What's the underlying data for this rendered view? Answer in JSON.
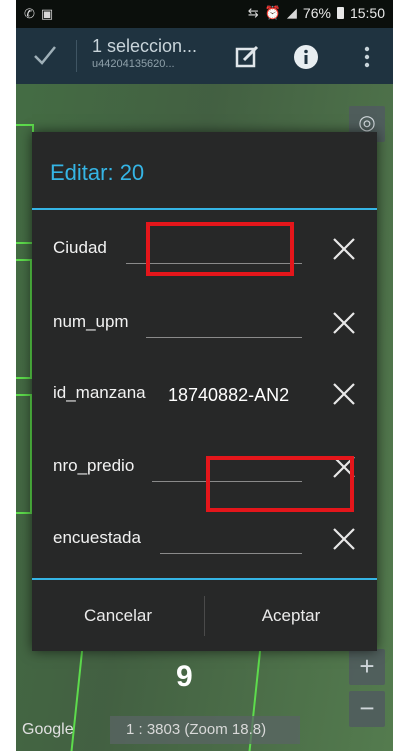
{
  "status_bar": {
    "battery": "76%",
    "time": "15:50"
  },
  "action_bar": {
    "title": "1 seleccion...",
    "subtitle": "u44204135620..."
  },
  "dialog": {
    "title": "Editar: 20",
    "fields": [
      {
        "label": "Ciudad",
        "value": ""
      },
      {
        "label": "num_upm",
        "value": ""
      },
      {
        "label": "id_manzana",
        "value": "18740882-AN2"
      },
      {
        "label": "nro_predio",
        "value": ""
      },
      {
        "label": "encuestada",
        "value": ""
      }
    ],
    "cancel_label": "Cancelar",
    "accept_label": "Aceptar"
  },
  "map": {
    "big_number": "9",
    "provider": "Google",
    "scale_text": "1 : 3803 (Zoom 18.8)",
    "zoom_in": "+",
    "zoom_out": "−"
  },
  "colors": {
    "accent": "#35b5e5",
    "highlight": "#e4161b",
    "parcel": "#5ddc4c"
  },
  "icons": [
    "whatsapp-icon",
    "image-icon",
    "wifi-calling-icon",
    "alarm-icon",
    "signal-icon",
    "battery-icon",
    "check-icon",
    "edit-icon",
    "info-icon",
    "overflow-menu-icon",
    "location-icon",
    "close-icon"
  ]
}
